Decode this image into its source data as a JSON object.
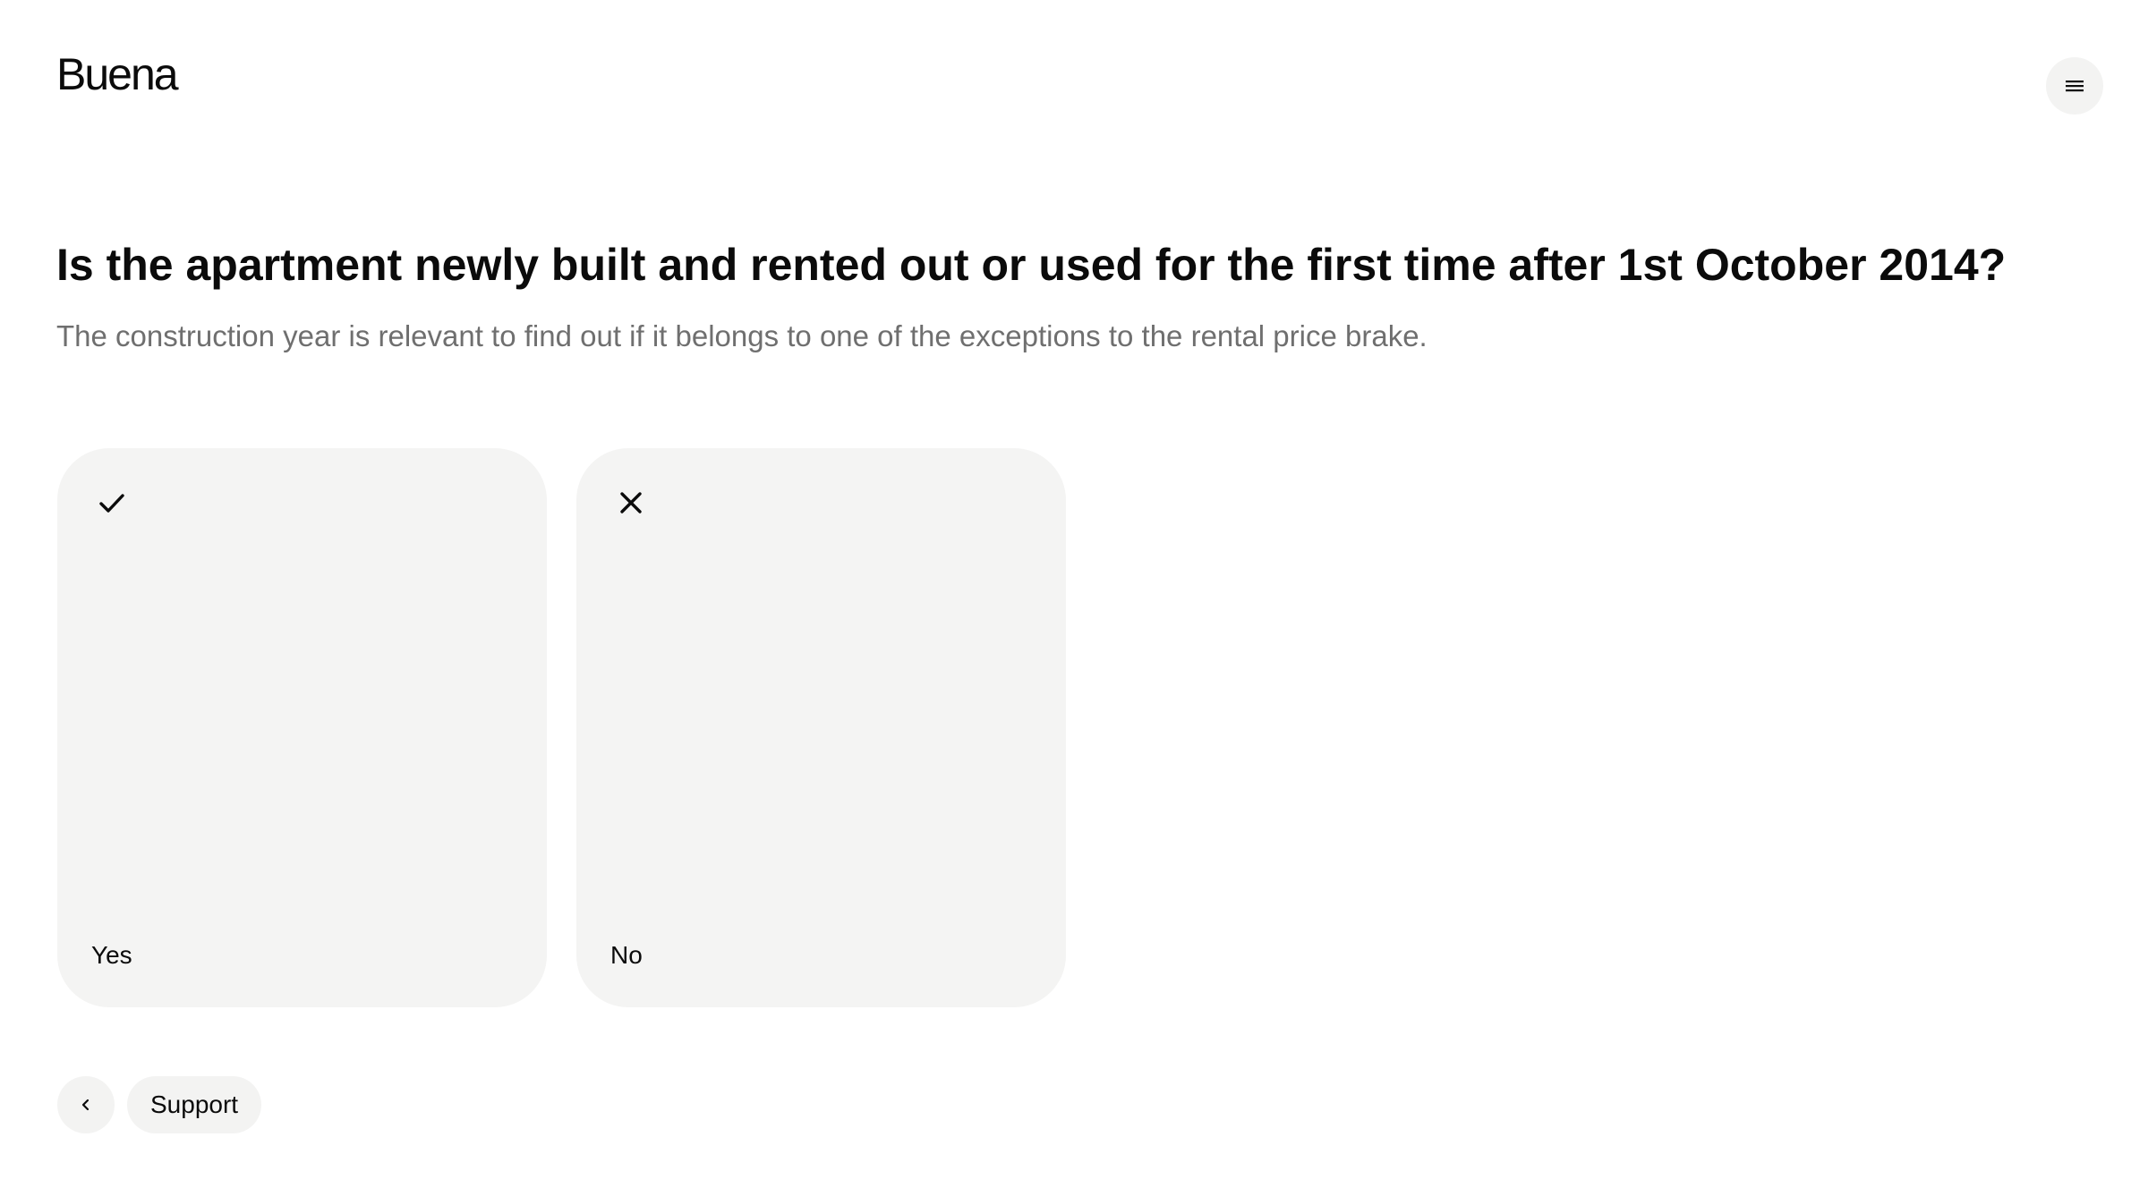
{
  "header": {
    "logo_text": "Buena",
    "menu_icon": "hamburger-icon"
  },
  "question": {
    "title": "Is the apartment newly built and rented out or used for the first time after 1st October 2014?",
    "subtitle": "The construction year is relevant to find out if it belongs to one of the exceptions to the rental price brake."
  },
  "options": [
    {
      "label": "Yes",
      "icon": "check-icon"
    },
    {
      "label": "No",
      "icon": "close-icon"
    }
  ],
  "footer": {
    "back_icon": "chevron-left-icon",
    "support_label": "Support"
  },
  "colors": {
    "card_background": "#f4f4f3",
    "button_background": "#f3f3f2",
    "text_primary": "#0b0b0b",
    "text_secondary": "#6f6f6f"
  }
}
